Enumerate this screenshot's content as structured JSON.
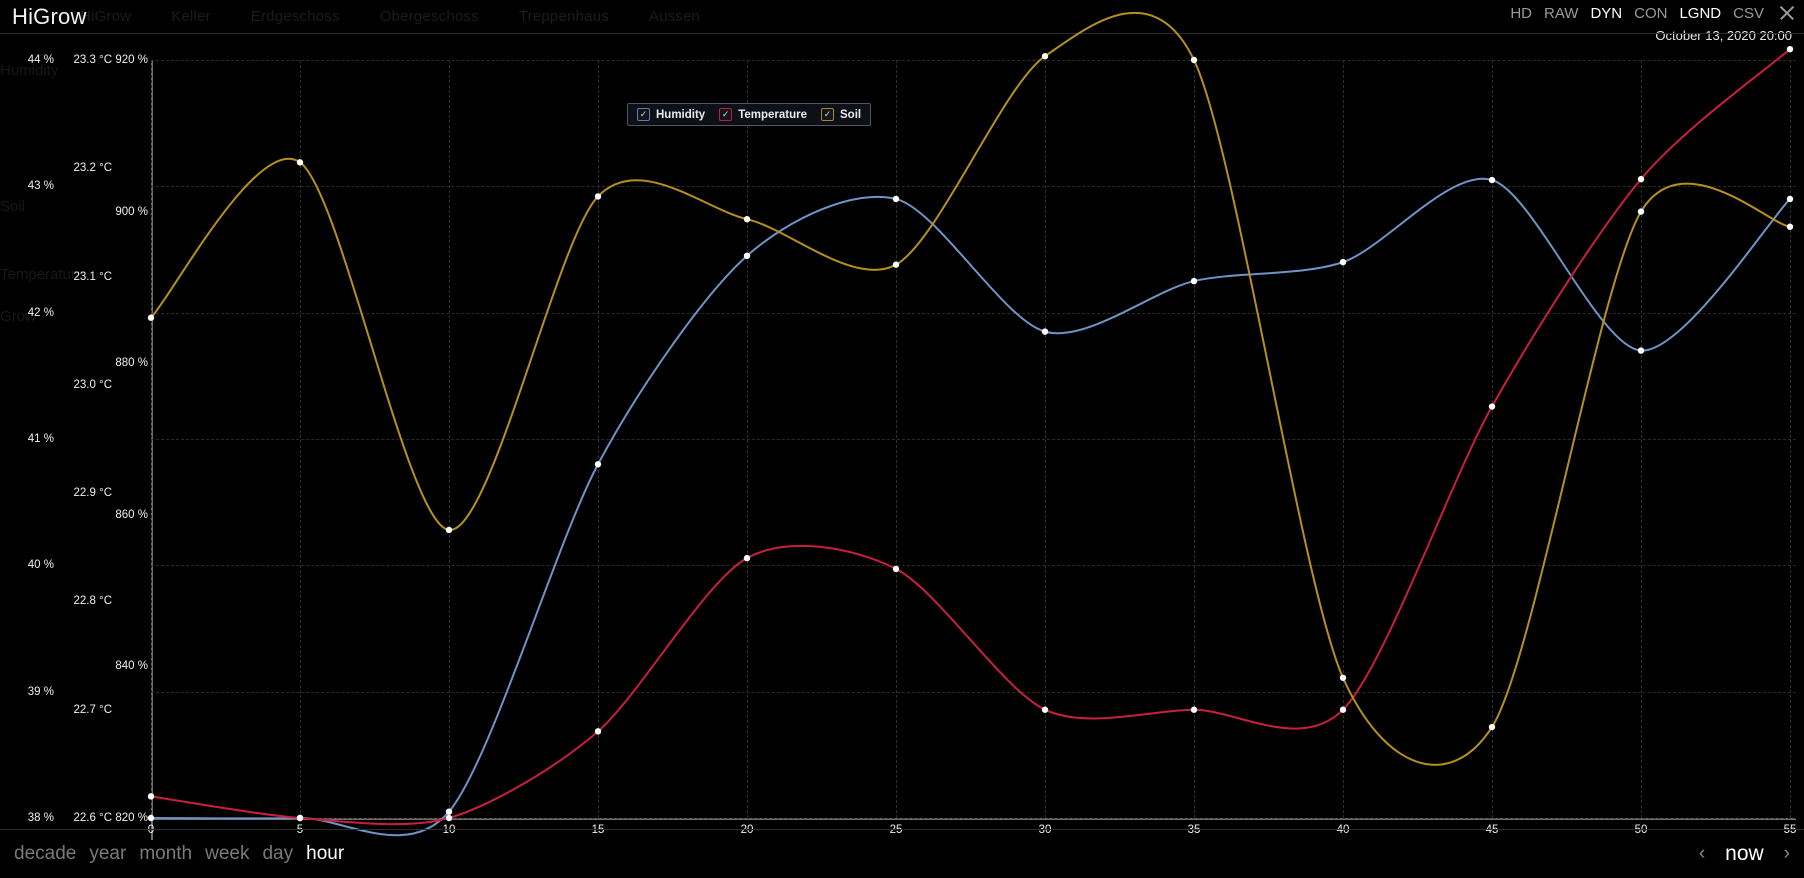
{
  "background": {
    "nav_items": [
      "HiGrow",
      "Keller",
      "Erdgeschoss",
      "Obergeschoss",
      "Treppenhaus",
      "Aussen"
    ],
    "side_labels": [
      "Humidity",
      "Soil",
      "Temperature",
      "Grow"
    ]
  },
  "header": {
    "title": "HiGrow",
    "options": [
      {
        "label": "HD",
        "active": false
      },
      {
        "label": "RAW",
        "active": false
      },
      {
        "label": "DYN",
        "active": true
      },
      {
        "label": "CON",
        "active": false
      },
      {
        "label": "LGND",
        "active": true
      },
      {
        "label": "CSV",
        "active": false
      }
    ],
    "close_icon": "close-icon",
    "date": "October 13, 2020 20:00"
  },
  "legend": {
    "items": [
      {
        "label": "Humidity",
        "color": "#6f93c6",
        "checked": true,
        "check": "✓"
      },
      {
        "label": "Temperature",
        "color": "#c8203c",
        "checked": true,
        "check": "✓"
      },
      {
        "label": "Soil",
        "color": "#b5901f",
        "checked": true,
        "check": "✓"
      }
    ]
  },
  "footer": {
    "scales": [
      {
        "label": "decade",
        "active": false
      },
      {
        "label": "year",
        "active": false
      },
      {
        "label": "month",
        "active": false
      },
      {
        "label": "week",
        "active": false
      },
      {
        "label": "day",
        "active": false
      },
      {
        "label": "hour",
        "active": true
      }
    ],
    "prev_icon": "‹",
    "now_label": "now",
    "next_icon": "›"
  },
  "chart_data": {
    "type": "line",
    "title": "",
    "xlabel": "",
    "grid": true,
    "legend_position": "top-center",
    "x": [
      0,
      5,
      10,
      15,
      20,
      25,
      30,
      35,
      40,
      45,
      50,
      55
    ],
    "x_ticks": [
      "0",
      "5",
      "10",
      "15",
      "20",
      "25",
      "30",
      "35",
      "40",
      "45",
      "50",
      "55"
    ],
    "axes": [
      {
        "name": "Humidity",
        "unit": "%",
        "color": "#6f93c6",
        "ticks": [
          "44 %",
          "43 %",
          "42 %",
          "41 %",
          "40 %",
          "39 %",
          "38 %"
        ],
        "tick_values": [
          44,
          43,
          42,
          41,
          40,
          39,
          38
        ],
        "ylim": [
          38,
          44
        ]
      },
      {
        "name": "Temperature",
        "unit": "°C",
        "color": "#c8203c",
        "ticks": [
          "23.3 °C",
          "23.2 °C",
          "23.1 °C",
          "23.0 °C",
          "22.9 °C",
          "22.8 °C",
          "22.7 °C",
          "22.6 °C"
        ],
        "tick_values": [
          23.3,
          23.2,
          23.1,
          23.0,
          22.9,
          22.8,
          22.7,
          22.6
        ],
        "ylim": [
          22.6,
          23.3
        ]
      },
      {
        "name": "Soil",
        "unit": "%",
        "color": "#b5901f",
        "ticks": [
          "920 %",
          "900 %",
          "880 %",
          "860 %",
          "840 %",
          "820 %"
        ],
        "tick_values": [
          920,
          900,
          880,
          860,
          840,
          820
        ],
        "ylim": [
          820,
          920
        ]
      }
    ],
    "series": [
      {
        "name": "Humidity",
        "unit": "%",
        "color": "#6f93c6",
        "axis": "Humidity",
        "values": [
          38.0,
          38.0,
          38.05,
          40.8,
          42.45,
          42.9,
          41.85,
          42.25,
          42.4,
          43.05,
          41.7,
          42.9
        ]
      },
      {
        "name": "Temperature",
        "unit": "°C",
        "color": "#c8203c",
        "axis": "Temperature",
        "values": [
          22.62,
          22.6,
          22.6,
          22.68,
          22.84,
          22.83,
          22.7,
          22.7,
          22.7,
          22.98,
          23.19,
          23.31
        ]
      },
      {
        "name": "Soil",
        "unit": "%",
        "color": "#b5901f",
        "axis": "Soil",
        "values": [
          886.0,
          906.5,
          858.0,
          902.0,
          899.0,
          893.0,
          920.5,
          920.0,
          838.5,
          832.0,
          900.0,
          898.0
        ]
      }
    ]
  }
}
